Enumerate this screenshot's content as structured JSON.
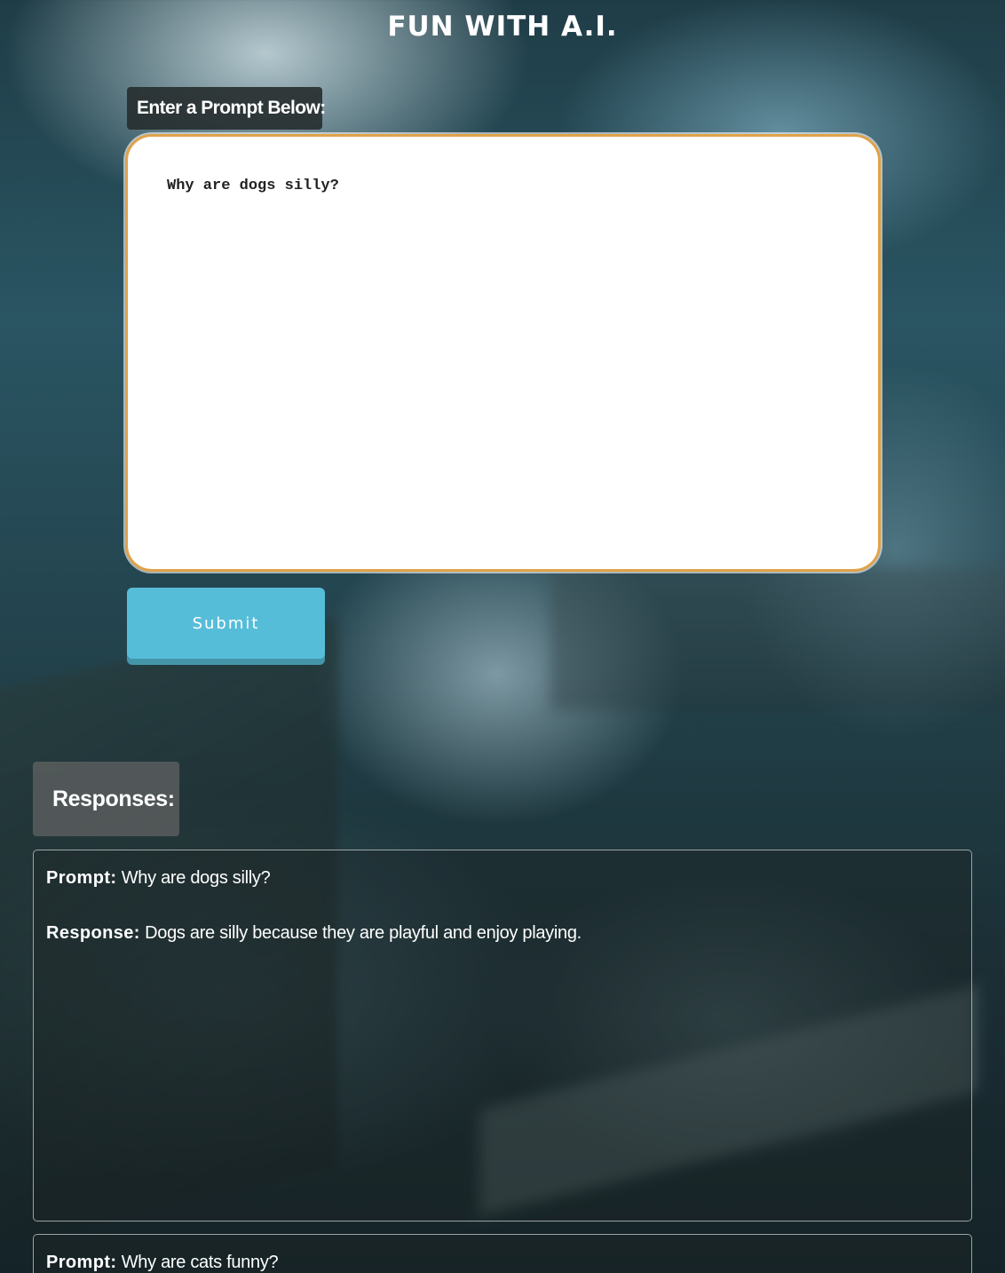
{
  "header": {
    "title": "FUN WITH A.I."
  },
  "prompt_form": {
    "label": "Enter a Prompt Below:",
    "input_value": "Why are dogs silly?",
    "submit_label": "Submit"
  },
  "responses": {
    "heading": "Responses:",
    "prompt_key": "Prompt:",
    "response_key": "Response:",
    "items": [
      {
        "prompt": "Why are dogs silly?",
        "response": "Dogs are silly because they are playful and enjoy playing."
      },
      {
        "prompt": "Why are cats funny?"
      }
    ]
  },
  "colors": {
    "input_border": "#e0a24a",
    "submit_button": "#56bdd9",
    "submit_shadow": "#4495aa"
  }
}
